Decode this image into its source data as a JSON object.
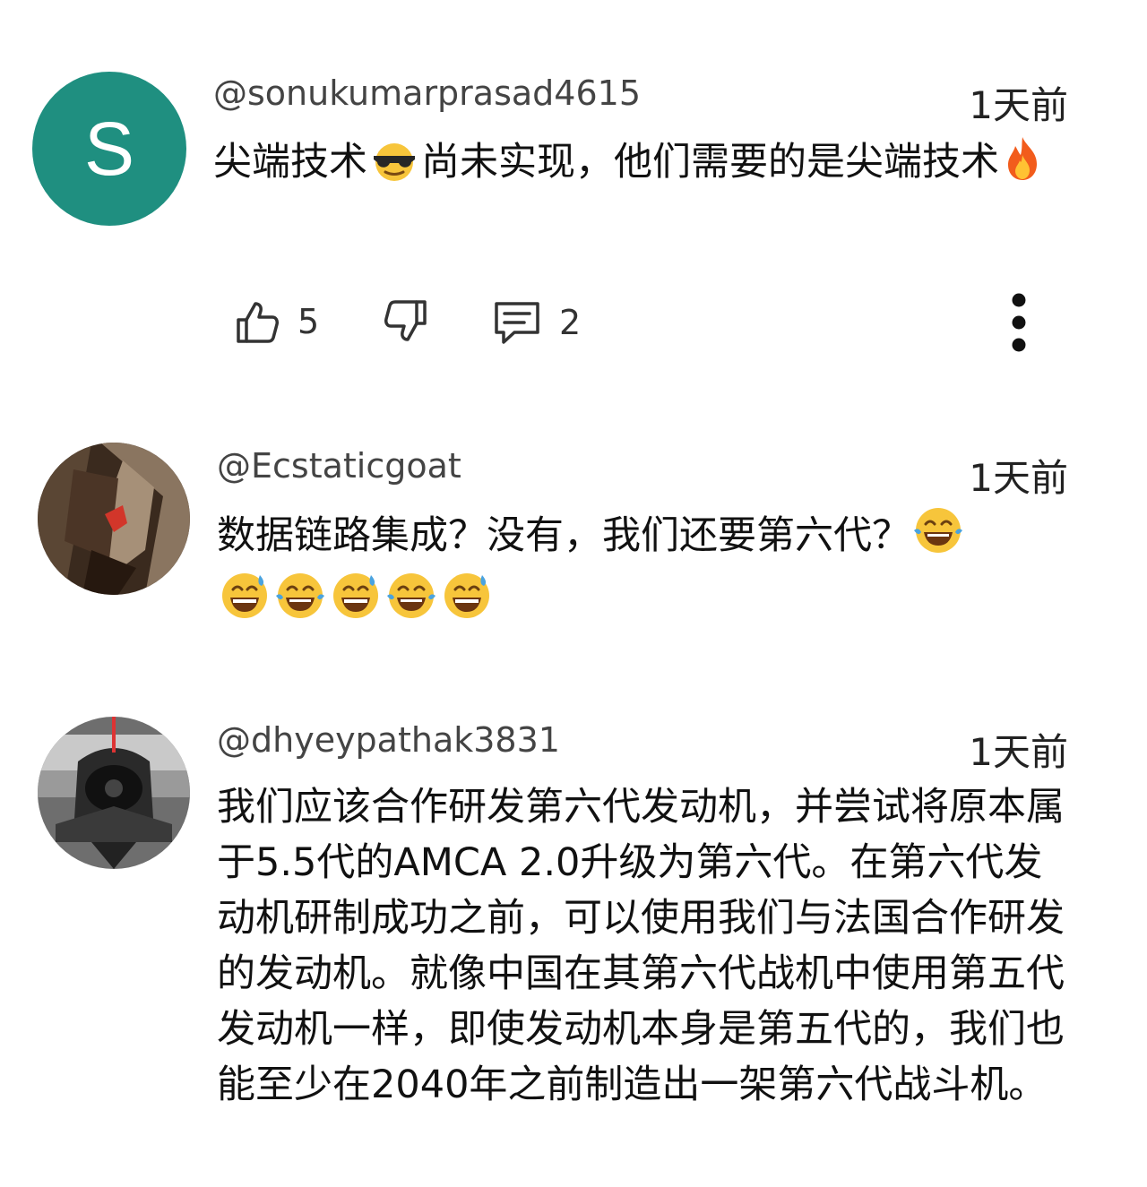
{
  "comments": [
    {
      "handle": "@sonukumarprasad4615",
      "time": "1天前",
      "avatar_letter": "S",
      "avatar_color": "#1f8f80",
      "text_parts": [
        "尖端技术",
        "尚未实现，他们需要的是尖端技术"
      ],
      "emojis": [
        "sunglasses-face",
        "fire"
      ],
      "likes": "5",
      "replies": "2"
    },
    {
      "handle": "@Ecstaticgoat",
      "time": "1天前",
      "text": "数据链路集成？没有，我们还要第六代？",
      "emojis": [
        "tears-of-joy",
        "grinning-sweat",
        "tears-of-joy",
        "grinning-sweat",
        "tears-of-joy",
        "grinning-sweat"
      ]
    },
    {
      "handle": "@dhyeypathak3831",
      "time": "1天前",
      "text": "我们应该合作研发第六代发动机，并尝试将原本属于5.5代的AMCA 2.0升级为第六代。在第六代发动机研制成功之前，可以使用我们与法国合作研发的发动机。就像中国在其第六代战机中使用第五代发动机一样，即使发动机本身是第五代的，我们也能至少在2040年之前制造出一架第六代战斗机。"
    }
  ]
}
